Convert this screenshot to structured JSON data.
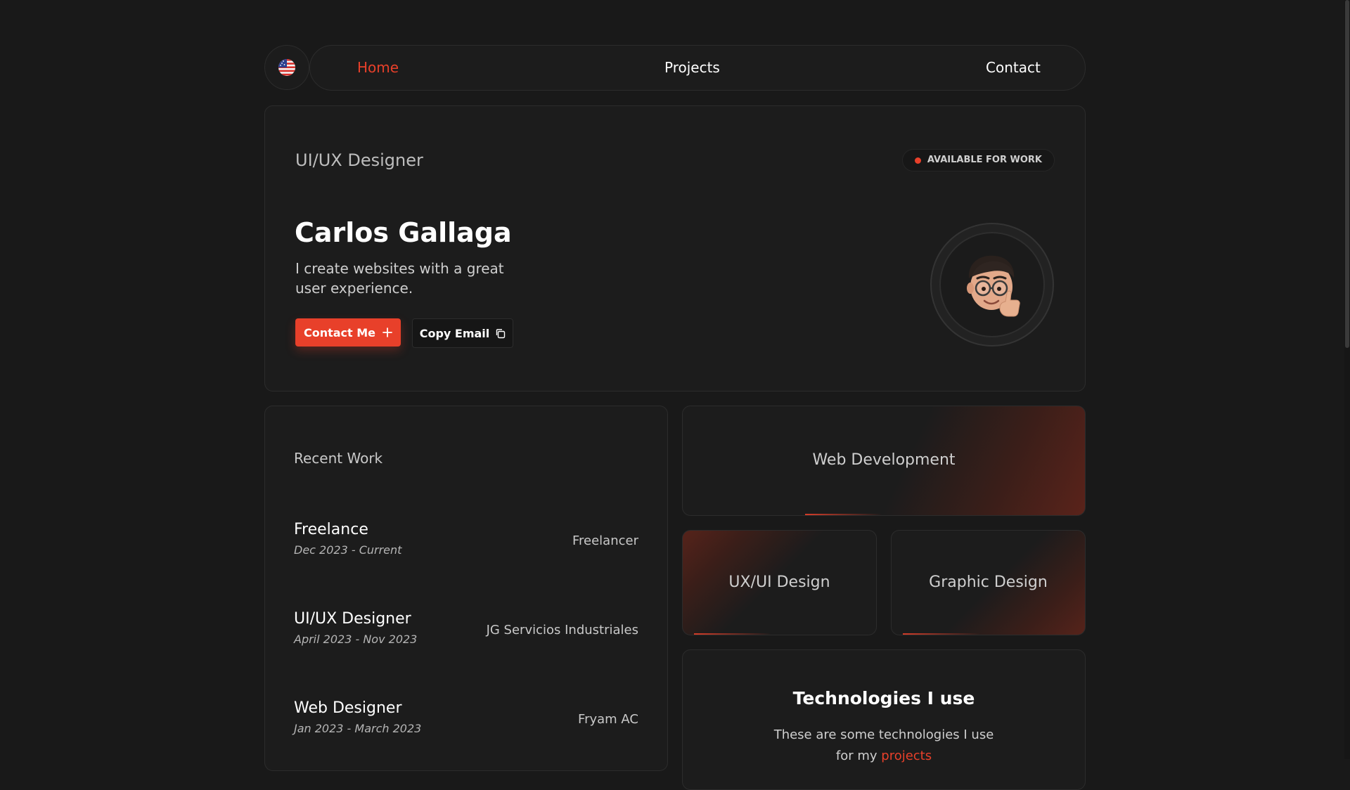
{
  "nav": {
    "language_icon": "us-flag-icon",
    "items": [
      {
        "label": "Home",
        "active": true
      },
      {
        "label": "Projects",
        "active": false
      },
      {
        "label": "Contact",
        "active": false
      }
    ]
  },
  "hero": {
    "role": "UI/UX Designer",
    "availability": "AVAILABLE FOR WORK",
    "name": "Carlos Gallaga",
    "tagline": "I create websites with a great user experience.",
    "contact_button": "Contact Me",
    "copy_email_button": "Copy Email"
  },
  "recent_work": {
    "title": "Recent Work",
    "items": [
      {
        "title": "Freelance",
        "dates": "Dec 2023 - Current",
        "company": "Freelancer"
      },
      {
        "title": "UI/UX Designer",
        "dates": "April 2023 - Nov 2023",
        "company": "JG Servicios Industriales"
      },
      {
        "title": "Web Designer",
        "dates": "Jan 2023 - March 2023",
        "company": "Fryam AC"
      }
    ]
  },
  "services": [
    {
      "label": "Web Development"
    },
    {
      "label": "UX/UI Design"
    },
    {
      "label": "Graphic Design"
    }
  ],
  "technologies": {
    "title": "Technologies I use",
    "text": "These are some technologies I use for my",
    "link": "projects"
  },
  "colors": {
    "accent": "#e8402a",
    "background": "#191919",
    "card": "#1c1c1c"
  }
}
